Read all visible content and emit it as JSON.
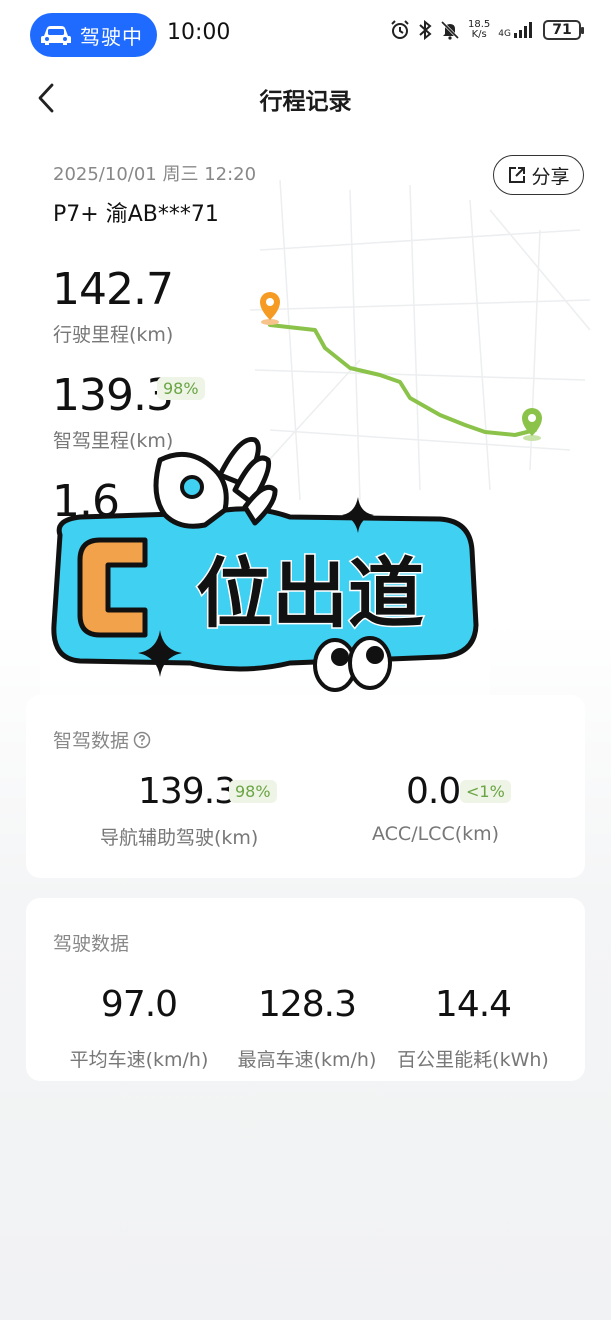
{
  "status_bar": {
    "driving_label": "驾驶中",
    "time": "10:00",
    "net_speed_top": "18.5",
    "net_speed_bottom": "K/s",
    "network": "4G",
    "battery": "71"
  },
  "header": {
    "title": "行程记录"
  },
  "trip": {
    "date": "2025/10/01 周三 12:20",
    "vehicle": "P7+ 渝AB***71",
    "share_label": "分享",
    "total_distance": "142.7",
    "total_distance_label": "行驶里程(km)",
    "smart_distance": "139.3",
    "smart_distance_pct": "98%",
    "smart_distance_label": "智驾里程(km)",
    "third_value": "1.6"
  },
  "sticker": {
    "text": "C位出道"
  },
  "smart_card": {
    "title": "智驾数据",
    "nav_value": "139.3",
    "nav_pct": "98%",
    "nav_label": "导航辅助驾驶(km)",
    "acc_value": "0.0",
    "acc_pct": "<1%",
    "acc_label": "ACC/LCC(km)"
  },
  "driving_card": {
    "title": "驾驶数据",
    "avg_speed": "97.0",
    "avg_speed_label": "平均车速(km/h)",
    "max_speed": "128.3",
    "max_speed_label": "最高车速(km/h)",
    "consumption": "14.4",
    "consumption_label": "百公里能耗(kWh)"
  },
  "colors": {
    "accent": "#1f6bff",
    "route": "#8bc34a",
    "start_pin": "#f59a23",
    "sticker_cyan": "#3fd0f2",
    "sticker_orange": "#f2a24a"
  }
}
